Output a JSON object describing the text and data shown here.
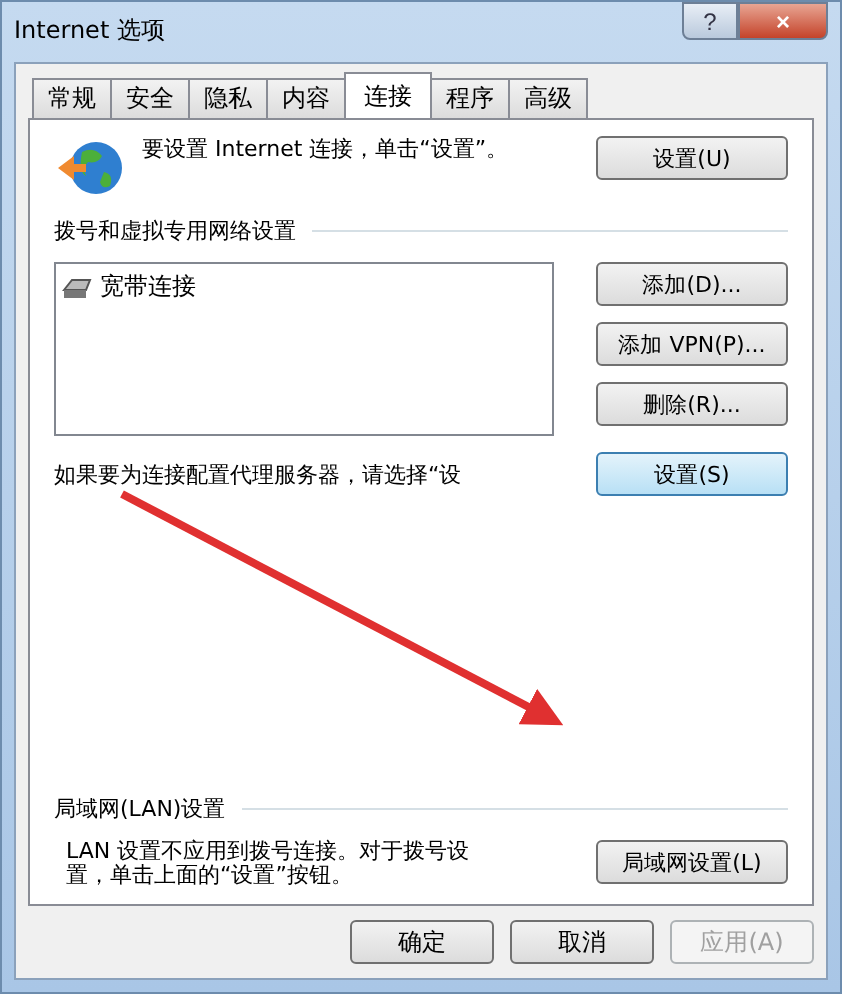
{
  "window": {
    "title": "Internet 选项",
    "help": "?",
    "close": "×"
  },
  "tabs": [
    {
      "label": "常规",
      "selected": false
    },
    {
      "label": "安全",
      "selected": false
    },
    {
      "label": "隐私",
      "selected": false
    },
    {
      "label": "内容",
      "selected": false
    },
    {
      "label": "连接",
      "selected": true
    },
    {
      "label": "程序",
      "selected": false
    },
    {
      "label": "高级",
      "selected": false
    }
  ],
  "setup": {
    "text": "要设置 Internet 连接，单击“设置”。",
    "button": "设置(U)"
  },
  "dialup": {
    "heading": "拨号和虚拟专用网络设置",
    "items": [
      {
        "label": "宽带连接",
        "selected": false
      }
    ],
    "buttons": [
      {
        "label": "添加(D)...",
        "focused": false
      },
      {
        "label": "添加 VPN(P)...",
        "focused": false
      },
      {
        "label": "删除(R)...",
        "focused": false
      }
    ],
    "proxy_text": "如果要为连接配置代理服务器，请选择“设",
    "settings_button": {
      "label": "设置(S)",
      "focused": true
    }
  },
  "lan": {
    "heading": "局域网(LAN)设置",
    "text": "LAN 设置不应用到拨号连接。对于拨号设置，单击上面的“设置”按钮。",
    "button": "局域网设置(L)"
  },
  "annotation": {
    "kind": "arrow"
  },
  "footer": [
    {
      "label": "确定",
      "disabled": false
    },
    {
      "label": "取消",
      "disabled": false
    },
    {
      "label": "应用(A)",
      "disabled": true
    }
  ]
}
